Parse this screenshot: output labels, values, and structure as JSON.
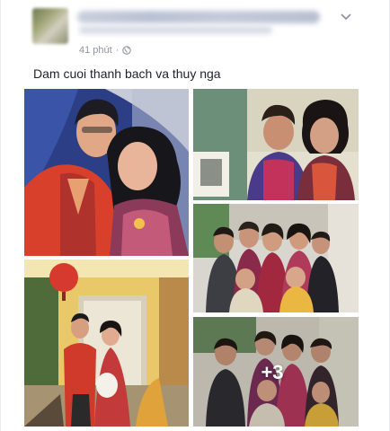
{
  "post": {
    "author_name": "",
    "time": "41 phút",
    "privacy_icon": "globe-icon",
    "separator": "·",
    "text": "Dam cuoi thanh bach va thuy nga",
    "menu_icon": "chevron-down-icon"
  },
  "photos": {
    "more_count": "+3",
    "items": [
      {
        "name": "photo-couple-portrait"
      },
      {
        "name": "photo-two-women-sofa"
      },
      {
        "name": "photo-group-women"
      },
      {
        "name": "photo-couple-doorway"
      },
      {
        "name": "photo-group-more"
      }
    ]
  },
  "colors": {
    "meta_text": "#90949c",
    "body_text": "#1d2129",
    "overlay_text": "#ffffff"
  }
}
